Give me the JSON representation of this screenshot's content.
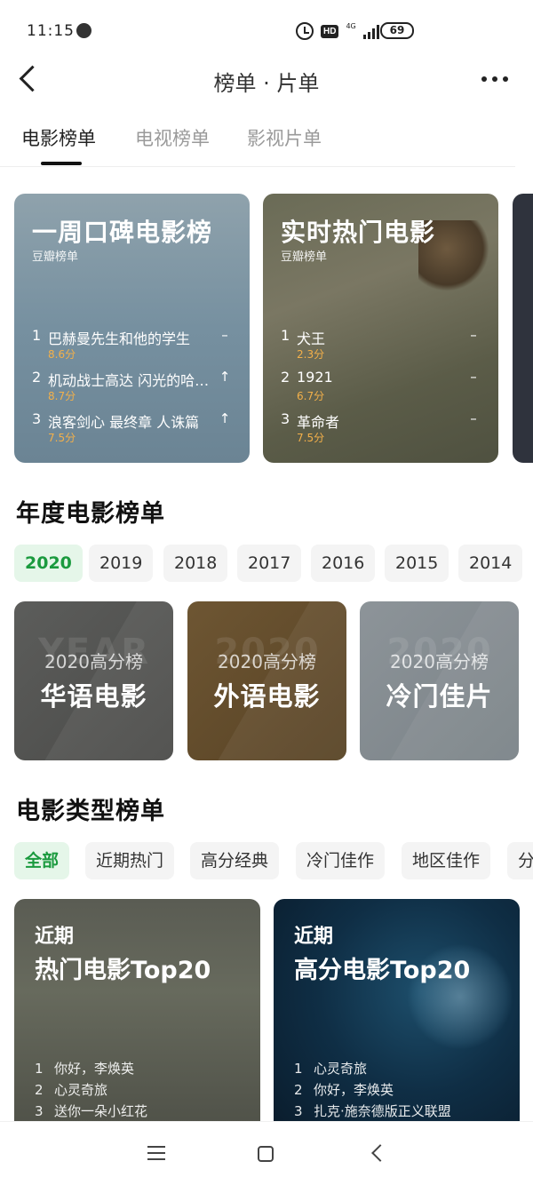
{
  "status": {
    "time": "11:15",
    "battery": "69",
    "network": "4G"
  },
  "header": {
    "title": "榜单 · 片单"
  },
  "tabs": [
    "电影榜单",
    "电视榜单",
    "影视片单"
  ],
  "weekly": [
    {
      "title": "一周口碑电影榜",
      "source": "豆瓣榜单",
      "items": [
        {
          "rank": "1",
          "name": "巴赫曼先生和他的学生",
          "score": "8.6分",
          "trend": "–"
        },
        {
          "rank": "2",
          "name": "机动战士高达 闪光的哈…",
          "score": "8.7分",
          "trend": "↑"
        },
        {
          "rank": "3",
          "name": "浪客剑心 最终章 人诛篇",
          "score": "7.5分",
          "trend": "↑"
        }
      ]
    },
    {
      "title": "实时热门电影",
      "source": "豆瓣榜单",
      "items": [
        {
          "rank": "1",
          "name": "犬王",
          "score": "2.3分",
          "trend": "–"
        },
        {
          "rank": "2",
          "name": "1921",
          "score": "6.7分",
          "trend": "–"
        },
        {
          "rank": "3",
          "name": "革命者",
          "score": "7.5分",
          "trend": "–"
        }
      ]
    }
  ],
  "annual": {
    "title": "年度电影榜单",
    "years": [
      "2020",
      "2019",
      "2018",
      "2017",
      "2016",
      "2015",
      "2014"
    ],
    "cards": [
      {
        "sub": "2020高分榜",
        "main": "华语电影",
        "watermark": "YEAR"
      },
      {
        "sub": "2020高分榜",
        "main": "外语电影",
        "watermark": "2020"
      },
      {
        "sub": "2020高分榜",
        "main": "冷门佳片",
        "watermark": "2020"
      }
    ]
  },
  "genre": {
    "title": "电影类型榜单",
    "chips": [
      "全部",
      "近期热门",
      "高分经典",
      "冷门佳作",
      "地区佳作",
      "分"
    ],
    "cards": [
      {
        "kicker": "近期",
        "heading": "热门电影Top20",
        "items": [
          "你好，李焕英",
          "心灵奇旅",
          "送你一朵小红花"
        ]
      },
      {
        "kicker": "近期",
        "heading": "高分电影Top20",
        "items": [
          "心灵奇旅",
          "你好，李焕英",
          "扎克·施奈德版正义联盟"
        ]
      }
    ]
  },
  "colors": {
    "accent_green": "#1a9a3e",
    "score_orange": "#f3b04a"
  }
}
